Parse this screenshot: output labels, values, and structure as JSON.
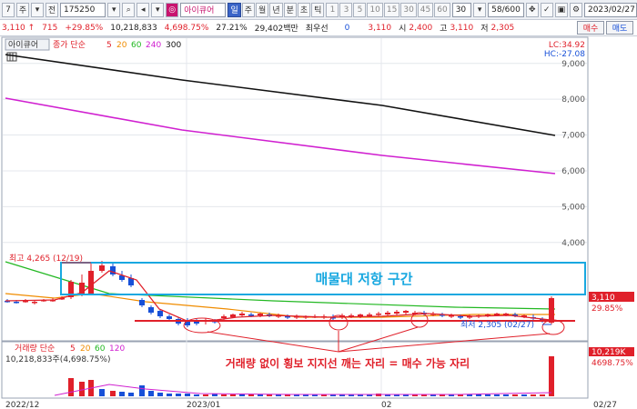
{
  "toolbar": {
    "btn_7": "7",
    "btn_ju": "주",
    "btn_jeon": "전",
    "code": "175250",
    "stock_name": "아이큐어",
    "periods": [
      "일",
      "주",
      "월",
      "년",
      "분",
      "초",
      "틱"
    ],
    "minutes": [
      "1",
      "3",
      "5",
      "10",
      "15",
      "30",
      "45",
      "60"
    ],
    "count": "30",
    "page": "58/600",
    "date": "2023/02/27"
  },
  "quote": {
    "price": "3,110",
    "change": "715",
    "rate": "+29.85%",
    "volume": "10,218,833",
    "volume_rate": "4,698.75%",
    "turnover": "27.21%",
    "amount": "29,402백만",
    "hoga_label": "최우선",
    "hoga_val": "0",
    "hoga_price": "3,110",
    "open_label": "시",
    "open": "2,400",
    "high_label": "고",
    "high": "3,110",
    "low_label": "저",
    "low": "2,305",
    "buy": "매수",
    "sell": "매도"
  },
  "chart": {
    "stock_tag": "아이큐어",
    "legend_main": "종가 단순",
    "ma": [
      "5",
      "20",
      "60",
      "240",
      "300"
    ],
    "ma_colors": [
      "#e0202a",
      "#f08c00",
      "#22b822",
      "#d020d0",
      "#111111"
    ],
    "lc": "LC:34.92",
    "hc": "HC:-27.08",
    "y_ticks": [
      "9,000",
      "8,000",
      "7,000",
      "6,000",
      "5,000",
      "4,000"
    ],
    "high_mark": "최고 4,265 (12/19)",
    "low_mark": "최저 2,305 (02/27)",
    "cur_price": "3,110",
    "cur_rate": "29.85%",
    "resist_text": "매물대 저항 구간",
    "note_text": "거래량 없이 횡보 지지선 깨는 자리 = 매수 가능 자리",
    "vol_legend": "거래량 단순",
    "vol_ma": [
      "5",
      "20",
      "60",
      "120"
    ],
    "vol_info": "10,218,833주(4,698.75%)",
    "vol_last": "10,219K",
    "vol_last_rate": "4698.75%",
    "x_labels": [
      "2022/12",
      "2023/01",
      "02",
      "02/27"
    ]
  },
  "colors": {
    "up": "#e0202a",
    "down": "#1750d8",
    "resist": "#18a8e0"
  }
}
